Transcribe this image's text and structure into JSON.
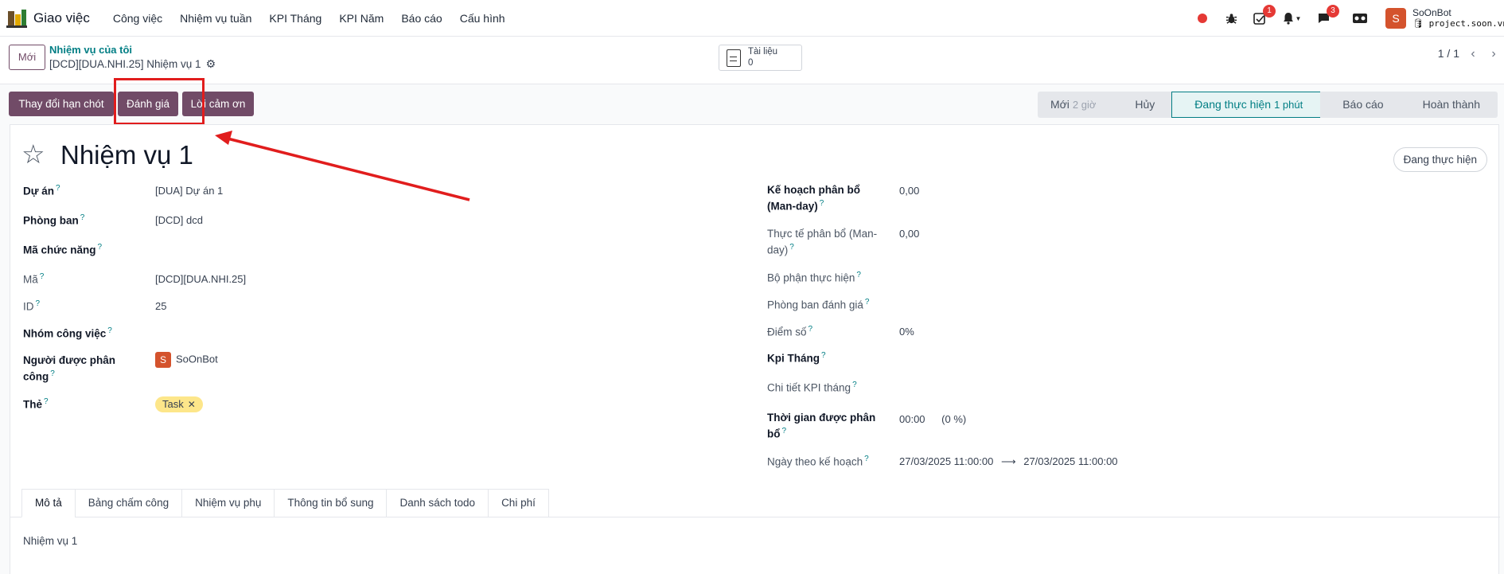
{
  "navbar": {
    "app_name": "Giao việc",
    "menu": [
      "Công việc",
      "Nhiệm vụ tuần",
      "KPI Tháng",
      "KPI Năm",
      "Báo cáo",
      "Cấu hình"
    ],
    "activity_badge": "1",
    "messages_badge": "3",
    "user_initial": "S",
    "user_name": "SoOnBot",
    "user_db": "project.soon.vn"
  },
  "control": {
    "new_label": "Mới",
    "breadcrumb_parent": "Nhiệm vụ của tôi",
    "breadcrumb_current": "[DCD][DUA.NHI.25] Nhiệm vụ 1",
    "documents_label": "Tài liệu",
    "documents_count": "0",
    "pager": "1 / 1"
  },
  "actions": {
    "change_deadline": "Thay đổi hạn chót",
    "evaluate": "Đánh giá",
    "thanks": "Lời cảm ơn"
  },
  "statusbar": [
    {
      "label": "Mới",
      "duration": "2 giờ"
    },
    {
      "label": "Hủy",
      "duration": ""
    },
    {
      "label": "Đang thực hiện",
      "duration": "1 phút",
      "active": true
    },
    {
      "label": "Báo cáo",
      "duration": ""
    },
    {
      "label": "Hoàn thành",
      "duration": ""
    }
  ],
  "form": {
    "title": "Nhiệm vụ 1",
    "stage_pill": "Đang thực hiện",
    "left": {
      "project_label": "Dự án",
      "project_value": "[DUA] Dự án 1",
      "dept_label": "Phòng ban",
      "dept_value": "[DCD] dcd",
      "function_label": "Mã chức năng",
      "code_label": "Mã",
      "code_value": "[DCD][DUA.NHI.25]",
      "id_label": "ID",
      "id_value": "25",
      "group_label": "Nhóm công việc",
      "assignee_label": "Người được phân công",
      "assignee_initial": "S",
      "assignee_value": "SoOnBot",
      "tags_label": "Thẻ",
      "tag_value": "Task"
    },
    "right": {
      "plan_alloc_label": "Kế hoạch phân bổ (Man-day)",
      "plan_alloc_value": "0,00",
      "actual_alloc_label": "Thực tế phân bổ (Man-day)",
      "actual_alloc_value": "0,00",
      "exec_dept_label": "Bộ phận thực hiện",
      "eval_dept_label": "Phòng ban đánh giá",
      "score_label": "Điểm số",
      "score_value": "0%",
      "kpi_month_label": "Kpi Tháng",
      "kpi_detail_label": "Chi tiết KPI tháng",
      "alloc_time_label": "Thời gian được phân bổ",
      "alloc_time_value": "00:00",
      "alloc_time_pct": "(0 %)",
      "plan_date_label": "Ngày theo kế hoạch",
      "plan_date_start": "27/03/2025 11:00:00",
      "plan_date_end": "27/03/2025 11:00:00"
    },
    "tabs": [
      "Mô tả",
      "Bảng chấm công",
      "Nhiệm vụ phụ",
      "Thông tin bổ sung",
      "Danh sách todo",
      "Chi phí"
    ],
    "description": "Nhiệm vụ 1"
  }
}
